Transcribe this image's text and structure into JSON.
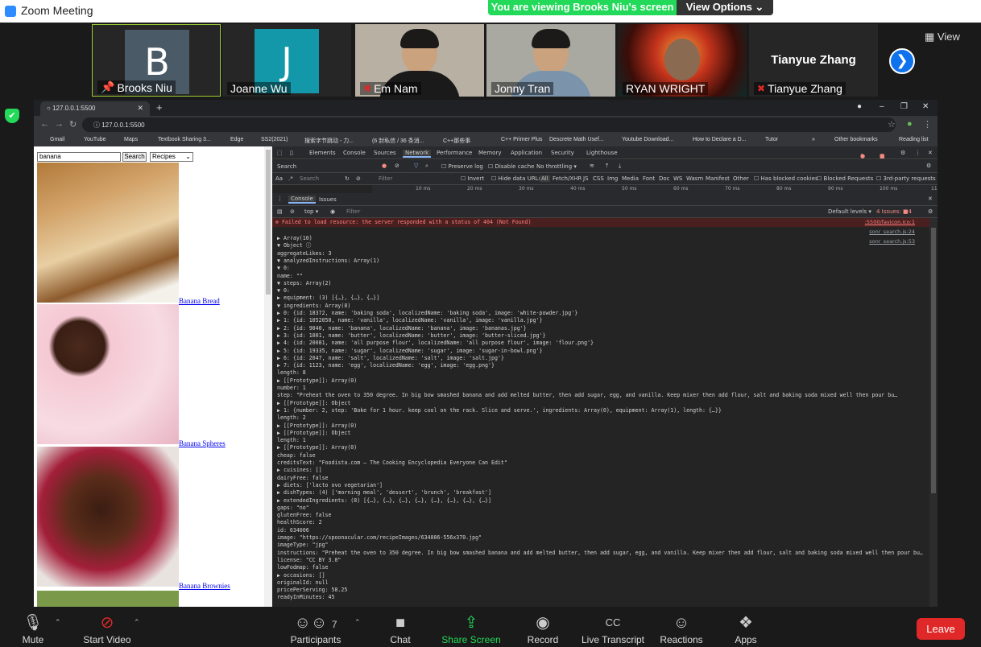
{
  "zoom": {
    "title": "Zoom Meeting",
    "banner": "You are viewing Brooks Niu's screen",
    "view_options": "View Options ⌄",
    "view_label": "View",
    "participants_strip": [
      {
        "name": "Brooks Niu",
        "initial": "B"
      },
      {
        "name": "Joanne Wu",
        "initial": "J"
      },
      {
        "name": "Em Nam"
      },
      {
        "name": "Jonny Tran"
      },
      {
        "name": "RYAN WRIGHT"
      },
      {
        "name": "Tianyue Zhang",
        "banner_name": "Tianyue Zhang"
      }
    ],
    "colors": {
      "avatar_b": "#4a5a66",
      "avatar_j": "#1298a8",
      "banner": "#23d959",
      "leave": "#e02828",
      "accent": "#0e72ed"
    }
  },
  "browser": {
    "tab_title": "127.0.0.1:5500",
    "url": "127.0.0.1:5500",
    "bookmarks": [
      "Gmail",
      "YouTube",
      "Maps",
      "Textbook Sharing 3...",
      "Edge",
      "SS2(2021)",
      "搜索字节跳动 - 力...",
      "(6 封私信 / 36 条消...",
      "C++那些事",
      "C++ Primer Plus",
      "Descrete Math Usef...",
      "Youtube Download...",
      "How to Declare a D...",
      "Tutor",
      "»",
      "Other bookmarks",
      "Reading list"
    ]
  },
  "page": {
    "search_value": "banana",
    "search_button": "Search",
    "category": "Recipes",
    "results": [
      {
        "title": "Banana Bread"
      },
      {
        "title": "Banana Spheres"
      },
      {
        "title": "Banana Brownies"
      }
    ]
  },
  "devtools": {
    "tabs": [
      "Elements",
      "Console",
      "Sources",
      "Network",
      "Performance",
      "Memory",
      "Application",
      "Security",
      "Lighthouse"
    ],
    "active_tab": "Network",
    "errors": "1",
    "warnings": "4",
    "net_toolbar": {
      "search": "Search",
      "preserve": "Preserve log",
      "disable_cache": "Disable cache",
      "throttle": "No throttling"
    },
    "filter": {
      "placeholder": "Filter",
      "invert": "Invert",
      "hide_data": "Hide data URLs",
      "types": [
        "All",
        "Fetch/XHR",
        "JS",
        "CSS",
        "Img",
        "Media",
        "Font",
        "Doc",
        "WS",
        "Wasm",
        "Manifest",
        "Other"
      ],
      "blocked_cookies": "Has blocked cookies",
      "blocked_req": "Blocked Requests",
      "third_party": "3rd-party requests"
    },
    "timeline": [
      "10 ms",
      "20 ms",
      "30 ms",
      "40 ms",
      "50 ms",
      "60 ms",
      "70 ms",
      "80 ms",
      "90 ms",
      "100 ms",
      "11"
    ],
    "console_tabs": [
      "Console",
      "Issues"
    ],
    "console_filter": {
      "context": "top",
      "placeholder": "Filter",
      "levels": "Default levels ▾",
      "issues": "4 Issues: ■4"
    },
    "error": "Failed to load resource: the server responded with a status of 404 (Not Found)",
    "error_src": ":5500/favicon.ico:1",
    "src1": "sonr_search.js:24",
    "src2": "sonr_search.js:53"
  },
  "console_lines": [
    "▶ Array(10)",
    "▼ Object ⓘ",
    "    aggregateLikes: 3",
    "  ▼ analyzedInstructions: Array(1)",
    "    ▼ 0:",
    "        name: \"\"",
    "      ▼ steps: Array(2)",
    "        ▼ 0:",
    "          ▶ equipment: (3) [{…}, {…}, {…}]",
    "          ▼ ingredients: Array(8)",
    "            ▶ 0: {id: 18372, name: 'baking soda', localizedName: 'baking soda', image: 'white-powder.jpg'}",
    "            ▶ 1: {id: 1052050, name: 'vanilla', localizedName: 'vanilla', image: 'vanilla.jpg'}",
    "            ▶ 2: {id: 9040, name: 'banana', localizedName: 'banana', image: 'bananas.jpg'}",
    "            ▶ 3: {id: 1001, name: 'butter', localizedName: 'butter', image: 'butter-sliced.jpg'}",
    "            ▶ 4: {id: 20081, name: 'all purpose flour', localizedName: 'all purpose flour', image: 'flour.png'}",
    "            ▶ 5: {id: 19335, name: 'sugar', localizedName: 'sugar', image: 'sugar-in-bowl.png'}",
    "            ▶ 6: {id: 2047, name: 'salt', localizedName: 'salt', image: 'salt.jpg'}",
    "            ▶ 7: {id: 1123, name: 'egg', localizedName: 'egg', image: 'egg.png'}",
    "              length: 8",
    "            ▶ [[Prototype]]: Array(0)",
    "            number: 1",
    "            step: \"Preheat the oven to 350 degree. In big bow smashed banana and add melted butter, then add sugar, egg, and vanilla. Keep mixer then add flour, salt and baking soda mixed well then pour bu…",
    "          ▶ [[Prototype]]: Object",
    "        ▶ 1: {number: 2, step: 'Bake for 1 hour. keep cool on the rack. Slice and serve.', ingredients: Array(0), equipment: Array(1), length: {…}}",
    "          length: 2",
    "        ▶ [[Prototype]]: Array(0)",
    "      ▶ [[Prototype]]: Object",
    "      length: 1",
    "    ▶ [[Prototype]]: Array(0)",
    "    cheap: false",
    "    creditsText: \"Foodista.com – The Cooking Encyclopedia Everyone Can Edit\"",
    "  ▶ cuisines: []",
    "    dairyFree: false",
    "  ▶ diets: ['lacto ovo vegetarian']",
    "  ▶ dishTypes: (4) ['morning meal', 'dessert', 'brunch', 'breakfast']",
    "  ▶ extendedIngredients: (8) [{…}, {…}, {…}, {…}, {…}, {…}, {…}, {…}]",
    "    gaps: \"no\"",
    "    glutenFree: false",
    "    healthScore: 2",
    "    id: 634006",
    "    image: \"https://spoonacular.com/recipeImages/634006-556x370.jpg\"",
    "    imageType: \"jpg\"",
    "    instructions: \"Preheat the oven to 350 degree. In big bow smashed banana and add melted butter, then add sugar, egg, and vanilla. Keep mixer then add flour, salt and baking soda mixed well then pour bu…",
    "    license: \"CC BY 3.0\"",
    "    lowFodmap: false",
    "  ▶ occasions: []",
    "    originalId: null",
    "    pricePerServing: 58.25",
    "    readyInMinutes: 45"
  ],
  "toolbar": {
    "mute": "Mute",
    "video": "Start Video",
    "participants": "Participants",
    "participants_count": "7",
    "chat": "Chat",
    "share": "Share Screen",
    "record": "Record",
    "transcript": "Live Transcript",
    "reactions": "Reactions",
    "apps": "Apps",
    "leave": "Leave"
  }
}
